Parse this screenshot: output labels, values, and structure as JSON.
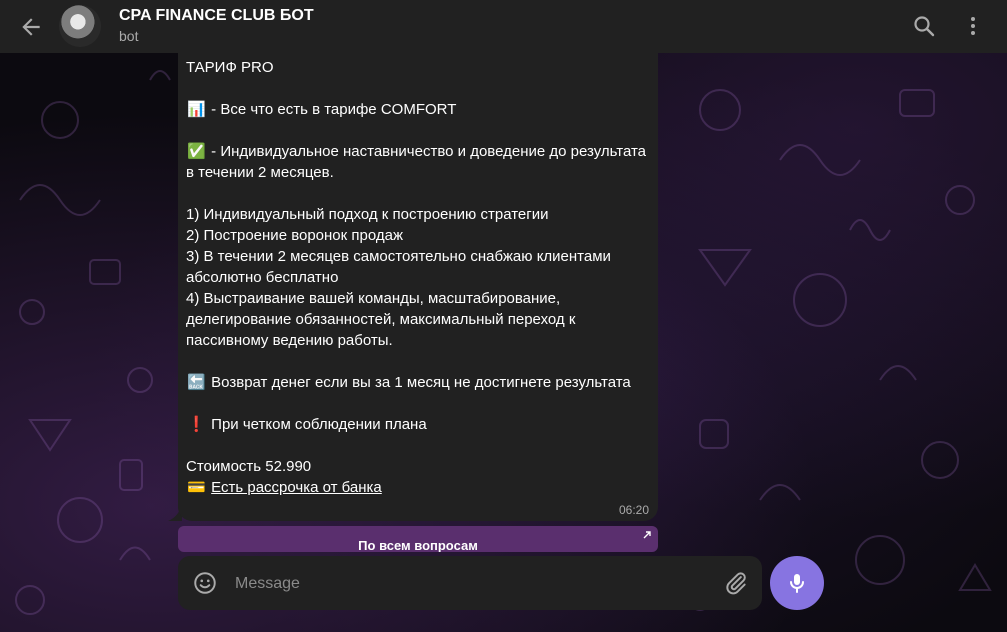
{
  "header": {
    "title": "CPA FINANCE CLUB БОТ",
    "subtitle": "bot"
  },
  "message": {
    "line_title": "ТАРИФ PRO",
    "p1_emoji": "📊",
    "p1_text": " - Все что есть в тарифе COMFORT",
    "p2_emoji": "✅",
    "p2_text": " - Индивидуальное наставничество и доведение до результата в течении 2 месяцев.",
    "list": [
      "1) Индивидуальный подход к построению стратегии",
      "2) Построение воронок продаж",
      "3) В течении 2 месяцев самостоятельно снабжаю клиентами абсолютно бесплатно",
      "4) Выстраивание вашей команды, масштабирование, делегирование обязанностей, максимальный переход к пассивному ведению работы."
    ],
    "p3_emoji": "🔙",
    "p3_text": " Возврат денег если вы за 1 месяц не достигнете результата",
    "p4_emoji": "❗",
    "p4_text": " При четком соблюдении плана",
    "price": "Стоимость 52.990",
    "p5_emoji": "💳",
    "installment_link": "Есть рассрочка от банка",
    "time": "06:20"
  },
  "inline_button": {
    "label": "По всем вопросам"
  },
  "composer": {
    "placeholder": "Message"
  },
  "colors": {
    "header_bg": "#212121",
    "bubble_bg": "#212121",
    "accent": "#8774e1",
    "inline_button_bg": "#5a2f6e"
  },
  "icons": {
    "back": "arrow-left-icon",
    "search": "search-icon",
    "more": "more-vertical-icon",
    "emoji": "smiley-icon",
    "attach": "paperclip-icon",
    "mic": "microphone-icon",
    "external": "external-link-icon"
  }
}
